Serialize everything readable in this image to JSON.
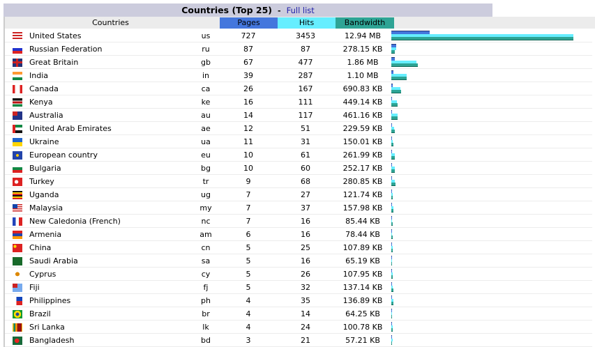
{
  "title": "Countries (Top 25)",
  "separator": "-",
  "full_list_link": "Full list",
  "columns": {
    "countries": "Countries",
    "pages": "Pages",
    "hits": "Hits",
    "bandwidth": "Bandwidth"
  },
  "colors": {
    "pages": "#4477dd",
    "hits": "#66eeff",
    "bandwidth": "#2ea495",
    "title_bg": "#ccccdd"
  },
  "rows": [
    {
      "name": "United States",
      "code": "us",
      "pages": 727,
      "hits": 3453,
      "bandwidth": "12.94 MB"
    },
    {
      "name": "Russian Federation",
      "code": "ru",
      "pages": 87,
      "hits": 87,
      "bandwidth": "278.15 KB"
    },
    {
      "name": "Great Britain",
      "code": "gb",
      "pages": 67,
      "hits": 477,
      "bandwidth": "1.86 MB"
    },
    {
      "name": "India",
      "code": "in",
      "pages": 39,
      "hits": 287,
      "bandwidth": "1.10 MB"
    },
    {
      "name": "Canada",
      "code": "ca",
      "pages": 26,
      "hits": 167,
      "bandwidth": "690.83 KB"
    },
    {
      "name": "Kenya",
      "code": "ke",
      "pages": 16,
      "hits": 111,
      "bandwidth": "449.14 KB"
    },
    {
      "name": "Australia",
      "code": "au",
      "pages": 14,
      "hits": 117,
      "bandwidth": "461.16 KB"
    },
    {
      "name": "United Arab Emirates",
      "code": "ae",
      "pages": 12,
      "hits": 51,
      "bandwidth": "229.59 KB"
    },
    {
      "name": "Ukraine",
      "code": "ua",
      "pages": 11,
      "hits": 31,
      "bandwidth": "150.01 KB"
    },
    {
      "name": "European country",
      "code": "eu",
      "pages": 10,
      "hits": 61,
      "bandwidth": "261.99 KB"
    },
    {
      "name": "Bulgaria",
      "code": "bg",
      "pages": 10,
      "hits": 60,
      "bandwidth": "252.17 KB"
    },
    {
      "name": "Turkey",
      "code": "tr",
      "pages": 9,
      "hits": 68,
      "bandwidth": "280.85 KB"
    },
    {
      "name": "Uganda",
      "code": "ug",
      "pages": 7,
      "hits": 27,
      "bandwidth": "121.74 KB"
    },
    {
      "name": "Malaysia",
      "code": "my",
      "pages": 7,
      "hits": 37,
      "bandwidth": "157.98 KB"
    },
    {
      "name": "New Caledonia (French)",
      "code": "nc",
      "pages": 7,
      "hits": 16,
      "bandwidth": "85.44 KB"
    },
    {
      "name": "Armenia",
      "code": "am",
      "pages": 6,
      "hits": 16,
      "bandwidth": "78.44 KB"
    },
    {
      "name": "China",
      "code": "cn",
      "pages": 5,
      "hits": 25,
      "bandwidth": "107.89 KB"
    },
    {
      "name": "Saudi Arabia",
      "code": "sa",
      "pages": 5,
      "hits": 16,
      "bandwidth": "65.19 KB"
    },
    {
      "name": "Cyprus",
      "code": "cy",
      "pages": 5,
      "hits": 26,
      "bandwidth": "107.95 KB"
    },
    {
      "name": "Fiji",
      "code": "fj",
      "pages": 5,
      "hits": 32,
      "bandwidth": "137.14 KB"
    },
    {
      "name": "Philippines",
      "code": "ph",
      "pages": 4,
      "hits": 35,
      "bandwidth": "136.89 KB"
    },
    {
      "name": "Brazil",
      "code": "br",
      "pages": 4,
      "hits": 14,
      "bandwidth": "64.25 KB"
    },
    {
      "name": "Sri Lanka",
      "code": "lk",
      "pages": 4,
      "hits": 24,
      "bandwidth": "100.78 KB"
    },
    {
      "name": "Bangladesh",
      "code": "bd",
      "pages": 3,
      "hits": 21,
      "bandwidth": "57.21 KB"
    }
  ]
}
